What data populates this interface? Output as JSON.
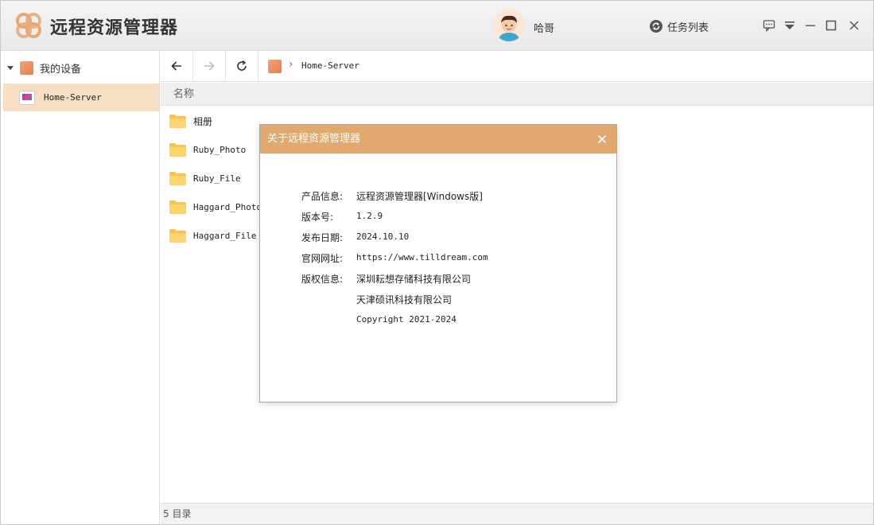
{
  "app": {
    "title": "远程资源管理器",
    "logo_icon": "app-logo-icon",
    "accent_color": "#e1a96d",
    "selection_color": "#f7dfc5"
  },
  "header": {
    "username": "哈哥",
    "task_list_label": "任务列表"
  },
  "sidebar": {
    "root_label": "我的设备",
    "items": [
      {
        "label": "Home-Server",
        "icon": "server-icon"
      }
    ]
  },
  "toolbar": {
    "breadcrumb": "Home-Server"
  },
  "list": {
    "column_name": "名称",
    "items": [
      {
        "name": "相册"
      },
      {
        "name": "Ruby_Photo"
      },
      {
        "name": "Ruby_File"
      },
      {
        "name": "Haggard_Photo"
      },
      {
        "name": "Haggard_File"
      }
    ]
  },
  "status": {
    "text": "5 目录"
  },
  "dialog": {
    "title": "关于远程资源管理器",
    "rows": [
      {
        "label": "产品信息:",
        "value": "远程资源管理器[Windows版]"
      },
      {
        "label": "版本号:",
        "value": "1.2.9"
      },
      {
        "label": "发布日期:",
        "value": "2024.10.10"
      },
      {
        "label": "官网网址:",
        "value": "https://www.tilldream.com"
      },
      {
        "label": "版权信息:",
        "value": "深圳耘想存储科技有限公司"
      },
      {
        "label": "",
        "value": "天津硕讯科技有限公司"
      },
      {
        "label": "",
        "value": "Copyright 2021-2024"
      }
    ]
  }
}
